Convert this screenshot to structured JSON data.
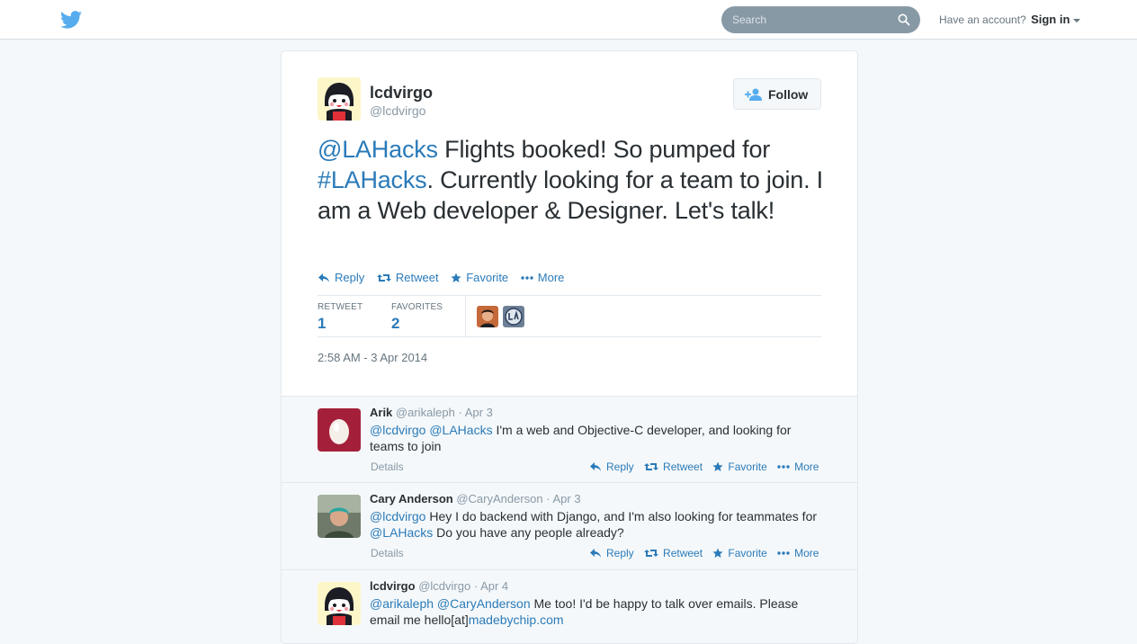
{
  "topbar": {
    "logo": "twitter-bird-icon",
    "search_placeholder": "Search",
    "account_text": "Have an account?",
    "signin_label": "Sign in"
  },
  "tweet": {
    "fullname": "lcdvirgo",
    "username": "@lcdvirgo",
    "follow_label": "Follow",
    "text_parts": {
      "mention": "@LAHacks",
      "t1": " Flights booked! So pumped for ",
      "hashtag": "#LAHacks",
      "t2": ". Currently looking for a team to join. I am a Web developer & Designer. Let's talk!"
    },
    "actions": {
      "reply": "Reply",
      "retweet": "Retweet",
      "favorite": "Favorite",
      "more": "More"
    },
    "stats": {
      "retweet_label": "RETWEET",
      "retweet_count": "1",
      "favorites_label": "FAVORITES",
      "favorites_count": "2"
    },
    "timestamp": "2:58 AM - 3 Apr 2014"
  },
  "replies": [
    {
      "name": "Arik",
      "username": "@arikaleph",
      "time": "Apr 3",
      "mention1": "@lcdvirgo",
      "mention2": "@LAHacks",
      "text": " I'm a web and Objective-C developer, and looking for teams to join",
      "details": "Details"
    },
    {
      "name": "Cary Anderson",
      "username": "@CaryAnderson",
      "time": "Apr 3",
      "mention1": "@lcdvirgo",
      "text1": " Hey I do backend with Django, and I'm also looking for teammates for ",
      "mention2": "@LAHacks",
      "text2": " Do you have any people already?",
      "details": "Details"
    },
    {
      "name": "lcdvirgo",
      "username": "@lcdvirgo",
      "time": "Apr 4",
      "mention1": "@arikaleph",
      "mention2": "@CaryAnderson",
      "text1": " Me too! I'd be happy to talk over emails. Please email me hello[at]",
      "link": "madebychip.com"
    }
  ],
  "reply_actions": {
    "reply": "Reply",
    "retweet": "Retweet",
    "favorite": "Favorite",
    "more": "More"
  },
  "colors": {
    "link": "#2b7bb9",
    "background": "#f5f8fa",
    "twitter_blue": "#55acee"
  }
}
